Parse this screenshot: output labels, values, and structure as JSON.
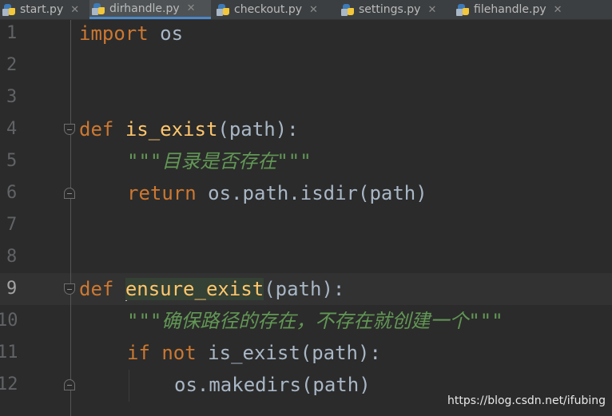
{
  "tabs": [
    {
      "label": "start.py",
      "active": false
    },
    {
      "label": "dirhandle.py",
      "active": true
    },
    {
      "label": "checkout.py",
      "active": false
    },
    {
      "label": "settings.py",
      "active": false
    },
    {
      "label": "filehandle.py",
      "active": false
    }
  ],
  "tab_close_glyph": "✕",
  "line_numbers": [
    "1",
    "2",
    "3",
    "4",
    "5",
    "6",
    "7",
    "8",
    "9",
    "10",
    "11",
    "12"
  ],
  "current_line": 9,
  "code": {
    "l1_kw": "import",
    "l1_rest": " os",
    "l4_kw": "def",
    "l4_fn": "is_exist",
    "l4_rest": "(path):",
    "l5_doc": "\"\"\"目录是否存在\"\"\"",
    "l6_kw": "return",
    "l6_rest": " os.path.isdir(path)",
    "l9_kw": "def",
    "l9_fn": "ensure_exist",
    "l9_rest": "(path):",
    "l10_doc": "\"\"\"确保路径的存在，不存在就创建一个\"\"\"",
    "l11_kw1": "if",
    "l11_kw2": "not",
    "l11_rest": " is_exist(path):",
    "l12_code": "os.makedirs(path)"
  },
  "watermark": "https://blog.csdn.net/ifubing",
  "colors": {
    "background": "#2b2b2b",
    "keyword": "#cc7832",
    "function": "#ffc66d",
    "docstring": "#629755",
    "text": "#a9b7c6",
    "tab_accent": "#4a88c7"
  }
}
